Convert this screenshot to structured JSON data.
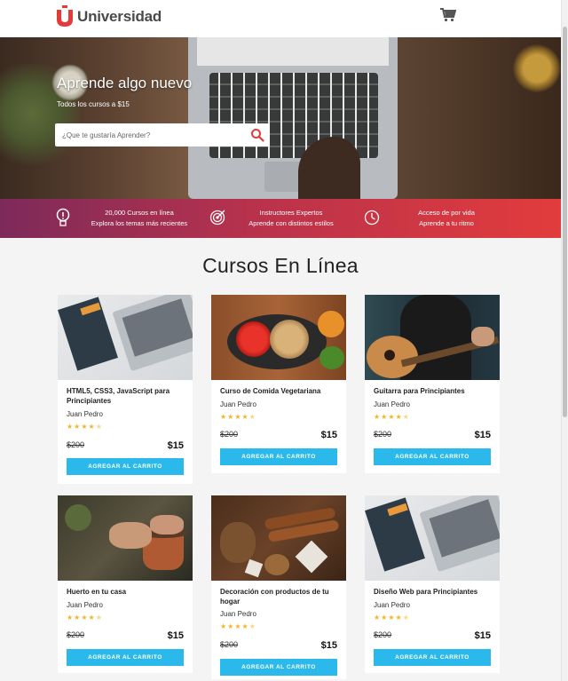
{
  "brand": {
    "logo_text": "Universidad",
    "accent": "#e63a3a"
  },
  "header": {
    "cart_icon": "cart-icon"
  },
  "hero": {
    "title": "Aprende algo nuevo",
    "subtitle": "Todos los cursos a $15",
    "search": {
      "placeholder": "¿Que te gustaría Aprender?",
      "value": ""
    },
    "search_icon": "search-icon"
  },
  "benefits": [
    {
      "icon": "lightbulb-icon",
      "line1": "20,000 Cursos en línea",
      "line2": "Explora los temas más recientes"
    },
    {
      "icon": "target-icon",
      "line1": "Instructores Expertos",
      "line2": "Aprende con distintos estilos"
    },
    {
      "icon": "clock-icon",
      "line1": "Acceso de por vida",
      "line2": "Aprende a tu ritmo"
    }
  ],
  "section": {
    "title": "Cursos En Línea"
  },
  "colors": {
    "button": "#2bb8ea",
    "stars": "#f1b52a"
  },
  "courses": [
    {
      "title": "HTML5, CSS3, JavaScript para Principiantes",
      "author": "Juan Pedro",
      "rating": 4.5,
      "old_price": "$200",
      "price": "$15",
      "button": "AGREGAR AL CARRITO",
      "image": "laptop-notebook"
    },
    {
      "title": "Curso de Comida Vegetariana",
      "author": "Juan Pedro",
      "rating": 4.5,
      "old_price": "$200",
      "price": "$15",
      "button": "AGREGAR AL CARRITO",
      "image": "vegetables-pan"
    },
    {
      "title": "Guitarra para Principiantes",
      "author": "Juan Pedro",
      "rating": 4.5,
      "old_price": "$200",
      "price": "$15",
      "button": "AGREGAR AL CARRITO",
      "image": "guitar"
    },
    {
      "title": "Huerto en tu casa",
      "author": "Juan Pedro",
      "rating": 4.5,
      "old_price": "$200",
      "price": "$15",
      "button": "AGREGAR AL CARRITO",
      "image": "plant-pot"
    },
    {
      "title": "Decoración con productos de tu hogar",
      "author": "Juan Pedro",
      "rating": 4.5,
      "old_price": "$200",
      "price": "$15",
      "button": "AGREGAR AL CARRITO",
      "image": "cinnamon-pinecones"
    },
    {
      "title": "Diseño Web para Principiantes",
      "author": "Juan Pedro",
      "rating": 4.5,
      "old_price": "$200",
      "price": "$15",
      "button": "AGREGAR AL CARRITO",
      "image": "laptop-notebook"
    }
  ]
}
